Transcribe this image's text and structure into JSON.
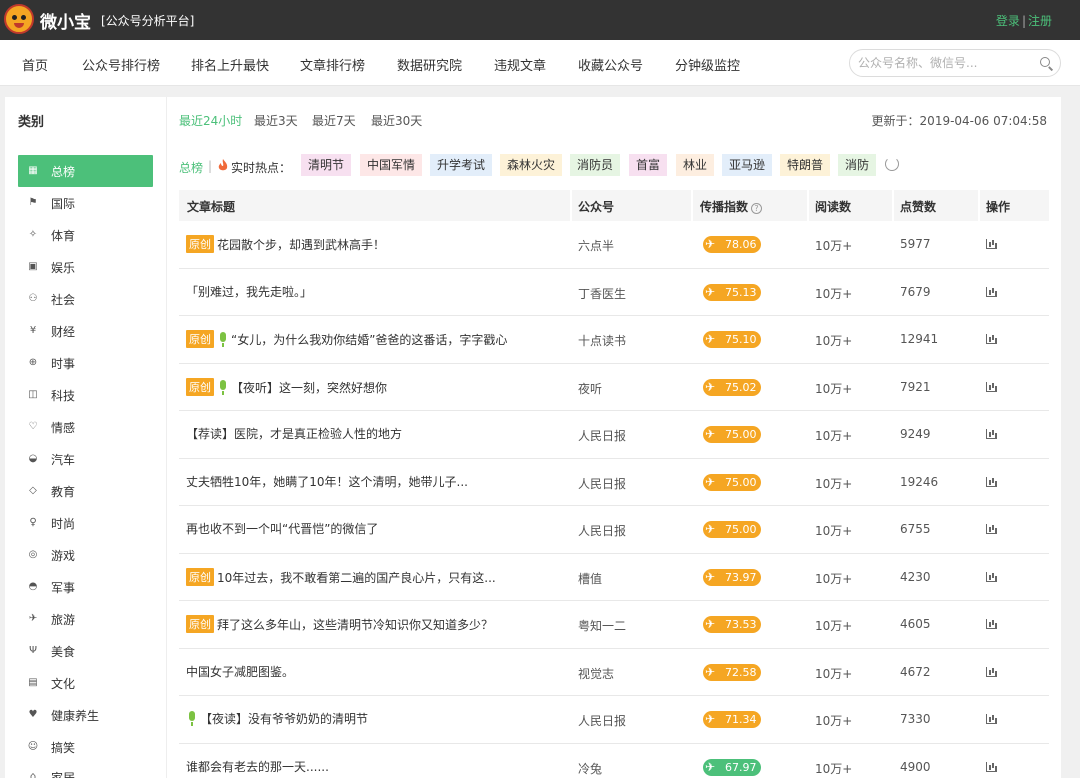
{
  "header": {
    "brand": "微小宝",
    "subtitle": "[公众号分析平台]",
    "login": "登录",
    "separator": "|",
    "register": "注册"
  },
  "nav": {
    "items": [
      "首页",
      "公众号排行榜",
      "排名上升最快",
      "文章排行榜",
      "数据研究院",
      "违规文章",
      "收藏公众号",
      "分钟级监控"
    ]
  },
  "search": {
    "placeholder": "公众号名称、微信号..."
  },
  "sidebar": {
    "title": "类别",
    "categories": [
      {
        "label": "总榜",
        "icon": "grid-icon",
        "active": true
      },
      {
        "label": "国际",
        "icon": "globe-flag-icon"
      },
      {
        "label": "体育",
        "icon": "runner-icon"
      },
      {
        "label": "娱乐",
        "icon": "tv-icon"
      },
      {
        "label": "社会",
        "icon": "people-icon"
      },
      {
        "label": "财经",
        "icon": "yen-icon"
      },
      {
        "label": "时事",
        "icon": "globe-icon"
      },
      {
        "label": "科技",
        "icon": "chip-icon"
      },
      {
        "label": "情感",
        "icon": "heart-icon"
      },
      {
        "label": "汽车",
        "icon": "car-icon"
      },
      {
        "label": "教育",
        "icon": "graduation-icon"
      },
      {
        "label": "时尚",
        "icon": "female-icon"
      },
      {
        "label": "游戏",
        "icon": "gamepad-icon"
      },
      {
        "label": "军事",
        "icon": "helmet-icon"
      },
      {
        "label": "旅游",
        "icon": "travel-icon"
      },
      {
        "label": "美食",
        "icon": "cutlery-icon"
      },
      {
        "label": "文化",
        "icon": "book-icon"
      },
      {
        "label": "健康养生",
        "icon": "health-icon"
      },
      {
        "label": "搞笑",
        "icon": "smile-icon"
      },
      {
        "label": "家居",
        "icon": "house-icon"
      }
    ]
  },
  "filters": {
    "ranges": [
      "最近24小时",
      "最近3天",
      "最近7天",
      "最近30天"
    ],
    "active_range": 0,
    "updated": "更新于：2019-04-06 07:04:58"
  },
  "hot": {
    "label": "总榜",
    "separator": "|",
    "title": "实时热点：",
    "tags": [
      {
        "text": "清明节",
        "color": "#f7e0f0"
      },
      {
        "text": "中国军情",
        "color": "#fde7e7"
      },
      {
        "text": "升学考试",
        "color": "#e3eefa"
      },
      {
        "text": "森林火灾",
        "color": "#fdf2d8"
      },
      {
        "text": "消防员",
        "color": "#e6f5e3"
      },
      {
        "text": "首富",
        "color": "#f7e0f0"
      },
      {
        "text": "林业",
        "color": "#fdeee0"
      },
      {
        "text": "亚马逊",
        "color": "#e3eefa"
      },
      {
        "text": "特朗普",
        "color": "#fdf2d8"
      },
      {
        "text": "消防",
        "color": "#e6f5e3"
      }
    ]
  },
  "table": {
    "headers": {
      "title": "文章标题",
      "account": "公众号",
      "spread": "传播指数",
      "reads": "阅读数",
      "likes": "点赞数",
      "ops": "操作"
    },
    "original_label": "原创",
    "rows": [
      {
        "orig": true,
        "audio": false,
        "title": "花园散个步，却遇到武林高手！",
        "account": "六点半",
        "spread": "78.06",
        "level": "orange",
        "reads": "10万+",
        "likes": "5977"
      },
      {
        "orig": false,
        "audio": false,
        "title": "「别难过，我先走啦。」",
        "account": "丁香医生",
        "spread": "75.13",
        "level": "orange",
        "reads": "10万+",
        "likes": "7679"
      },
      {
        "orig": true,
        "audio": true,
        "title": "“女儿，为什么我劝你结婚”爸爸的这番话，字字戳心",
        "account": "十点读书",
        "spread": "75.10",
        "level": "orange",
        "reads": "10万+",
        "likes": "12941"
      },
      {
        "orig": true,
        "audio": true,
        "title": "【夜听】这一刻，突然好想你",
        "account": "夜听",
        "spread": "75.02",
        "level": "orange",
        "reads": "10万+",
        "likes": "7921"
      },
      {
        "orig": false,
        "audio": false,
        "title": "【荐读】医院，才是真正检验人性的地方",
        "account": "人民日报",
        "spread": "75.00",
        "level": "orange",
        "reads": "10万+",
        "likes": "9249"
      },
      {
        "orig": false,
        "audio": false,
        "title": "丈夫牺牲10年，她瞒了10年！这个清明，她带儿子...",
        "account": "人民日报",
        "spread": "75.00",
        "level": "orange",
        "reads": "10万+",
        "likes": "19246"
      },
      {
        "orig": false,
        "audio": false,
        "title": "再也收不到一个叫“代晋恺”的微信了",
        "account": "人民日报",
        "spread": "75.00",
        "level": "orange",
        "reads": "10万+",
        "likes": "6755"
      },
      {
        "orig": true,
        "audio": false,
        "title": "10年过去，我不敢看第二遍的国产良心片，只有这...",
        "account": "槽值",
        "spread": "73.97",
        "level": "orange",
        "reads": "10万+",
        "likes": "4230"
      },
      {
        "orig": true,
        "audio": false,
        "title": "拜了这么多年山，这些清明节冷知识你又知道多少？",
        "account": "粤知一二",
        "spread": "73.53",
        "level": "orange",
        "reads": "10万+",
        "likes": "4605"
      },
      {
        "orig": false,
        "audio": false,
        "title": "中国女子减肥图鉴。",
        "account": "视觉志",
        "spread": "72.58",
        "level": "orange",
        "reads": "10万+",
        "likes": "4672"
      },
      {
        "orig": false,
        "audio": true,
        "title": "【夜读】没有爷爷奶奶的清明节",
        "account": "人民日报",
        "spread": "71.34",
        "level": "orange",
        "reads": "10万+",
        "likes": "7330"
      },
      {
        "orig": false,
        "audio": false,
        "title": "谁都会有老去的那一天......",
        "account": "冷兔",
        "spread": "67.97",
        "level": "green",
        "reads": "10万+",
        "likes": "4900"
      }
    ]
  }
}
